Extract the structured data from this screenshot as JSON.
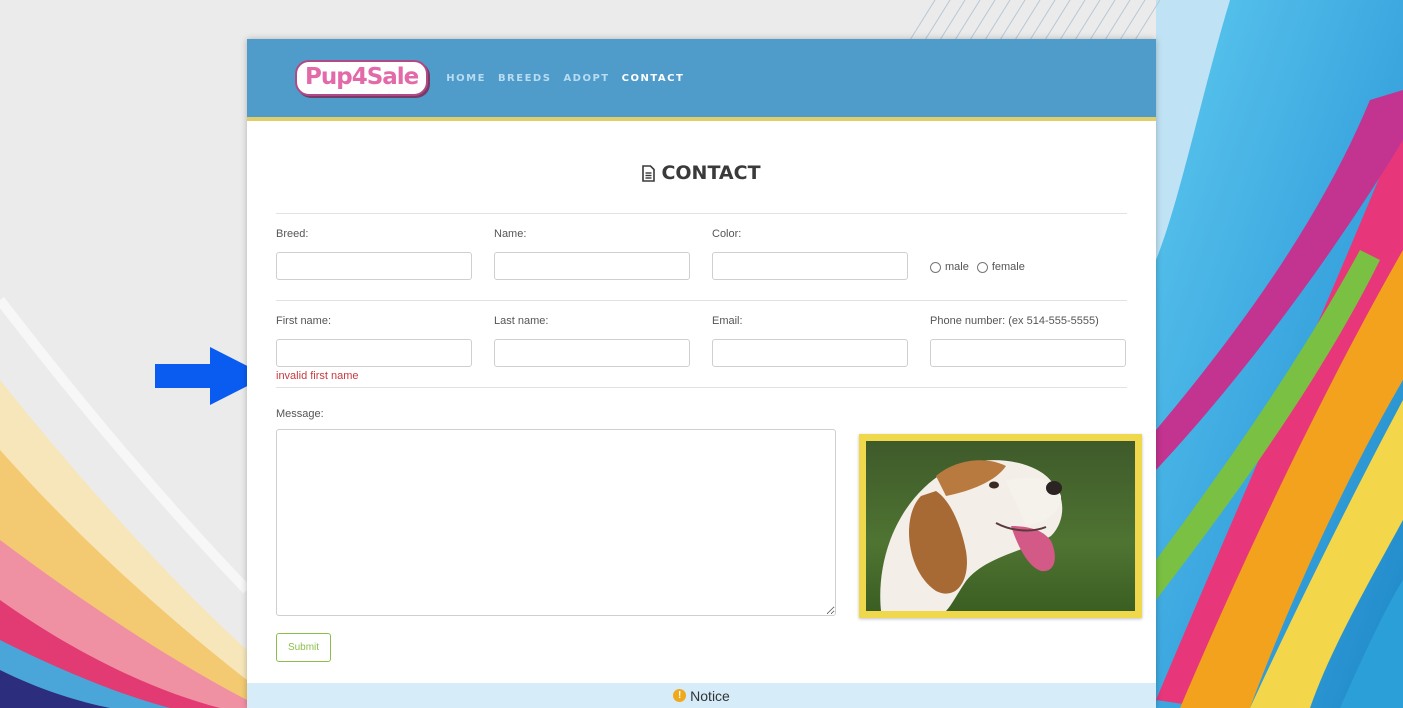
{
  "header": {
    "logo_text": "Pup4Sale",
    "nav": [
      {
        "label": "HOME",
        "active": false
      },
      {
        "label": "BREEDS",
        "active": false
      },
      {
        "label": "ADOPT",
        "active": false
      },
      {
        "label": "CONTACT",
        "active": true
      }
    ]
  },
  "page_title": "CONTACT",
  "pet_fields": {
    "breed": {
      "label": "Breed:",
      "value": ""
    },
    "name": {
      "label": "Name:",
      "value": ""
    },
    "color": {
      "label": "Color:",
      "value": ""
    },
    "gender": {
      "options": [
        "male",
        "female"
      ],
      "selected": ""
    }
  },
  "contact_fields": {
    "first_name": {
      "label": "First name:",
      "value": "",
      "error": "invalid first name"
    },
    "last_name": {
      "label": "Last name:",
      "value": ""
    },
    "email": {
      "label": "Email:",
      "value": ""
    },
    "phone": {
      "label": "Phone number: (ex 514-555-5555)",
      "value": ""
    }
  },
  "message": {
    "label": "Message:",
    "value": ""
  },
  "submit_label": "Submit",
  "notice": {
    "label": "Notice",
    "icon": "info-icon"
  },
  "colors": {
    "header": "#4f9bca",
    "accent_yellow": "#e0cf68",
    "error": "#c9393f",
    "submit": "#8bbf4a",
    "arrow": "#0a5cf0"
  }
}
